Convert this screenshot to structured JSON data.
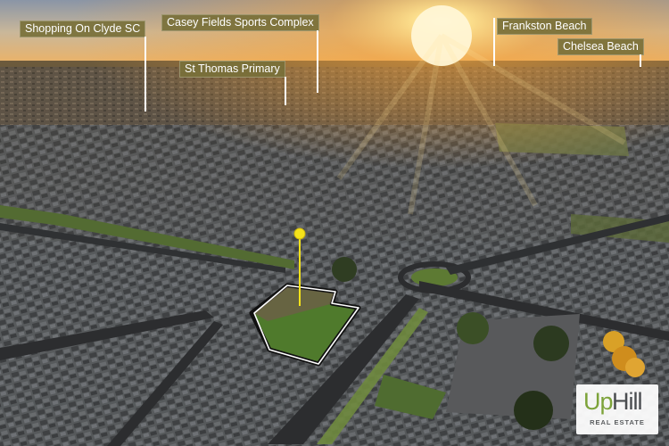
{
  "labels": {
    "shopping": "Shopping On Clyde SC",
    "casey": "Casey Fields Sports Complex",
    "st_thomas": "St Thomas Primary",
    "frankston": "Frankston Beach",
    "chelsea": "Chelsea Beach"
  },
  "logo": {
    "brand_up": "Up",
    "brand_hill": "Hill",
    "tagline": "REAL ESTATE"
  },
  "colors": {
    "label_bg": "#78703a",
    "sun": "#fff2c0",
    "lot_outline": "#111111",
    "lot_grass": "#4f7a2c",
    "pin_marker": "#f5e21a",
    "brand_green": "#7da33a",
    "brand_grey": "#4a4d50"
  }
}
